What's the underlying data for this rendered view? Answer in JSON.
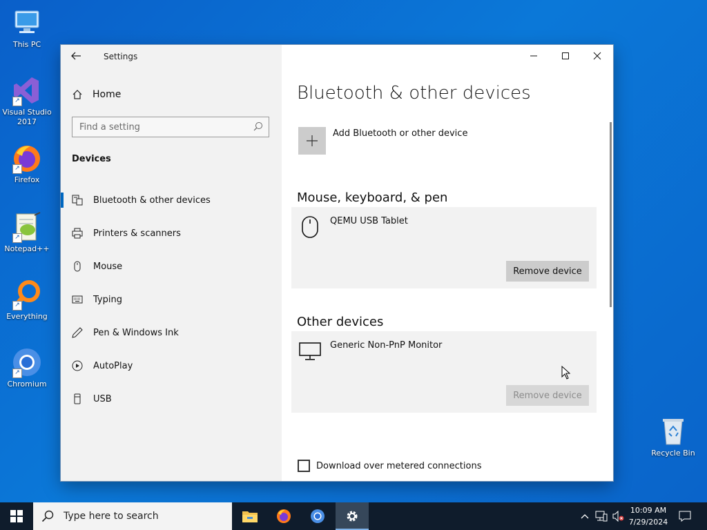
{
  "desktop": {
    "icons": [
      {
        "label_1": "This PC",
        "label_2": ""
      },
      {
        "label_1": "Visual Studio",
        "label_2": "2017"
      },
      {
        "label_1": "Firefox",
        "label_2": ""
      },
      {
        "label_1": "Notepad++",
        "label_2": ""
      },
      {
        "label_1": "Everything",
        "label_2": ""
      },
      {
        "label_1": "Chromium",
        "label_2": ""
      },
      {
        "label_1": "Recycle Bin",
        "label_2": ""
      }
    ]
  },
  "window": {
    "title": "Settings",
    "sidebar": {
      "home_label": "Home",
      "search_placeholder": "Find a setting",
      "section_label": "Devices",
      "items": [
        {
          "label": "Bluetooth & other devices",
          "icon": "bluetooth-devices-icon"
        },
        {
          "label": "Printers & scanners",
          "icon": "printer-icon"
        },
        {
          "label": "Mouse",
          "icon": "mouse-icon"
        },
        {
          "label": "Typing",
          "icon": "keyboard-icon"
        },
        {
          "label": "Pen & Windows Ink",
          "icon": "pen-icon"
        },
        {
          "label": "AutoPlay",
          "icon": "autoplay-icon"
        },
        {
          "label": "USB",
          "icon": "usb-icon"
        }
      ],
      "active_item": "Bluetooth & other devices"
    },
    "content": {
      "page_title": "Bluetooth & other devices",
      "add_device_label": "Add Bluetooth or other device",
      "groups": [
        {
          "title": "Mouse, keyboard, & pen",
          "device": {
            "name": "QEMU USB Tablet",
            "icon": "mouse-icon",
            "button": "Remove device",
            "button_enabled": true
          }
        },
        {
          "title": "Other devices",
          "device": {
            "name": "Generic Non-PnP Monitor",
            "icon": "monitor-icon",
            "button": "Remove device",
            "button_enabled": false
          }
        }
      ],
      "metered_label": "Download over metered connections",
      "metered_checked": false
    }
  },
  "taskbar": {
    "search_placeholder": "Type here to search",
    "apps": [
      "File Explorer",
      "Firefox",
      "Chromium",
      "Settings"
    ],
    "active_app": "Settings",
    "time": "10:09 AM",
    "date": "7/29/2024"
  },
  "colors": {
    "accent": "#0067c0",
    "desktop": "#0a6fd0",
    "taskbar": "#0f1c2c",
    "sidebar": "#f2f2f2",
    "card": "#f2f2f2"
  }
}
